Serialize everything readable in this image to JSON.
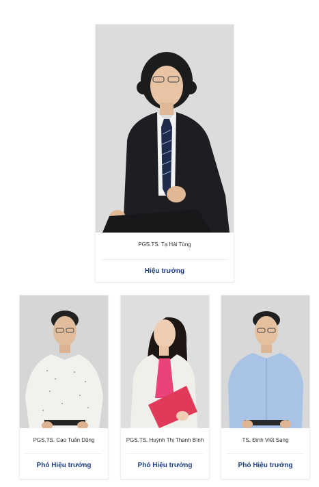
{
  "leader": {
    "name": "PGS.TS. Tạ Hải Tùng",
    "role": "Hiệu trưởng"
  },
  "deputies": [
    {
      "name": "PGS.TS. Cao Tuấn Dũng",
      "role": "Phó Hiệu trưởng"
    },
    {
      "name": "PGS.TS. Huỳnh Thị Thanh Bình",
      "role": "Phó Hiệu trưởng"
    },
    {
      "name": "TS. Đinh Viết Sang",
      "role": "Phó Hiệu trưởng"
    }
  ],
  "colors": {
    "role_text": "#1f3c88",
    "photo_bg": "#d9d9d9"
  }
}
